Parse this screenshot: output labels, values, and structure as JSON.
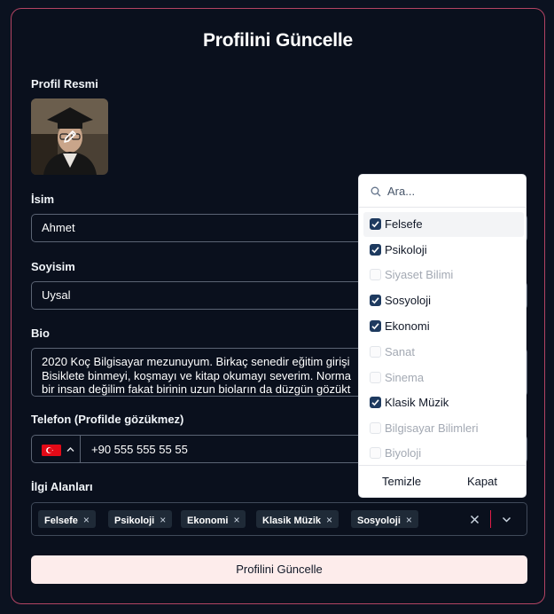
{
  "form": {
    "title": "Profilini Güncelle",
    "photo_label": "Profil Resmi",
    "name_label": "İsim",
    "name_value": "Ahmet",
    "surname_label": "Soyisim",
    "surname_value": "Uysal",
    "bio_label": "Bio",
    "bio_lines": [
      "2020 Koç Bilgisayar mezunuyum. Birkaç senedir eğitim girişi",
      "Bisiklete binmeyi, koşmayı ve kitap okumayı severim. Norma",
      "bir insan değilim fakat birinin uzun bioların da düzgün gözükt"
    ],
    "phone_label": "Telefon (Profilde gözükmez)",
    "phone_value": "+90 555 555 55 55",
    "interests_label": "İlgi Alanları",
    "tags": [
      "Felsefe",
      "Psikoloji",
      "Ekonomi",
      "Klasik Müzik",
      "Sosyoloji"
    ],
    "tag_remove_glyph": "×",
    "submit_label": "Profilini Güncelle"
  },
  "dropdown": {
    "search_placeholder": "Ara...",
    "options": [
      {
        "label": "Felsefe",
        "checked": true,
        "enabled": true
      },
      {
        "label": "Psikoloji",
        "checked": true,
        "enabled": true
      },
      {
        "label": "Siyaset Bilimi",
        "checked": false,
        "enabled": false
      },
      {
        "label": "Sosyoloji",
        "checked": true,
        "enabled": true
      },
      {
        "label": "Ekonomi",
        "checked": true,
        "enabled": true
      },
      {
        "label": "Sanat",
        "checked": false,
        "enabled": false
      },
      {
        "label": "Sinema",
        "checked": false,
        "enabled": false
      },
      {
        "label": "Klasik Müzik",
        "checked": true,
        "enabled": true
      },
      {
        "label": "Bilgisayar Bilimleri",
        "checked": false,
        "enabled": false
      },
      {
        "label": "Biyoloji",
        "checked": false,
        "enabled": false
      }
    ],
    "clear_label": "Temizle",
    "close_label": "Kapat"
  },
  "colors": {
    "background": "#0b1220",
    "card_border": "#b34463",
    "submit_bg": "#fdeceb",
    "checkbox": "#1e3a5f",
    "clear_divider": "#e11d48"
  },
  "icons": {
    "edit_photo": "pencil-icon",
    "flag": "turkey-flag-icon",
    "phone_country_toggle": "chevron-up-icon",
    "clear_tags": "close-icon",
    "tags_toggle": "chevron-down-icon",
    "search": "search-icon",
    "check": "check-icon"
  }
}
